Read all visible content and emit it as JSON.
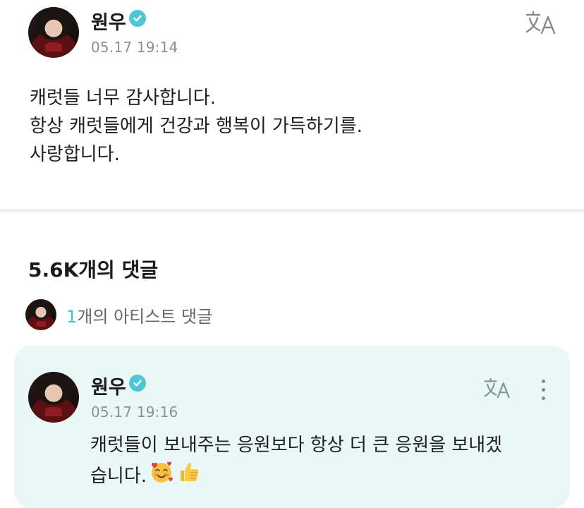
{
  "post": {
    "author": "원우",
    "date": "05.17 19:14",
    "lines": [
      "캐럿들 너무 감사합니다.",
      "항상 캐럿들에게 건강과 행복이 가득하기를.",
      "사랑합니다."
    ]
  },
  "comments": {
    "title": "5.6K개의 댓글",
    "artist_count_num": "1",
    "artist_count_label": "개의 아티스트 댓글"
  },
  "comment": {
    "author": "원우",
    "date": "05.17 19:16",
    "line1": "캐럿들이 보내주는 응원보다 항상 더 큰 응원을 보내겠",
    "line2": "습니다."
  },
  "colors": {
    "accent": "#4fc6d6",
    "card_bg": "#e9f8f6",
    "muted": "#8f8f8f"
  },
  "icons": [
    "verified-badge-icon",
    "translate-icon",
    "more-options-icon",
    "smiling-face-with-hearts-emoji",
    "thumbs-up-emoji"
  ]
}
